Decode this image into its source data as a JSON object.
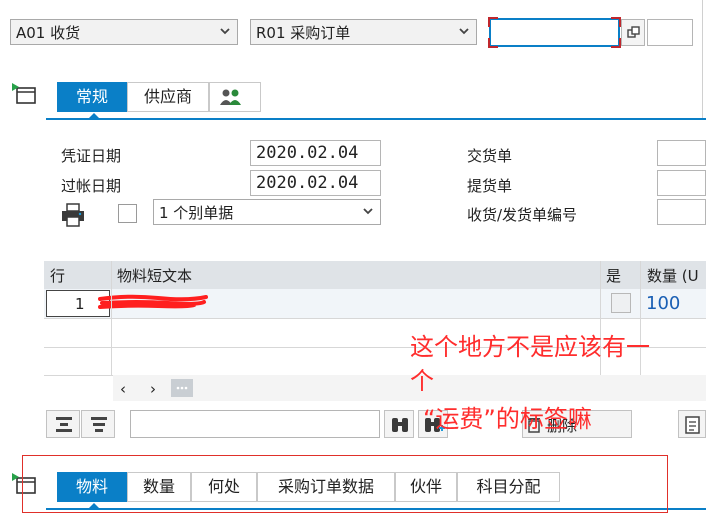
{
  "header": {
    "action": "A01 收货",
    "reference": "R01 采购订单"
  },
  "header_tabs": [
    {
      "label": "常规",
      "active": true
    },
    {
      "label": "供应商",
      "active": false
    }
  ],
  "general": {
    "doc_date_label": "凭证日期",
    "doc_date_value": "2020.02.04",
    "post_date_label": "过帐日期",
    "post_date_value": "2020.02.04",
    "slip_select": "1 个别单据",
    "delivery_note_label": "交货单",
    "bill_of_lading_label": "提货单",
    "gr_slip_label": "收货/发货单编号"
  },
  "table": {
    "headers": [
      "行",
      "物料短文本",
      "是",
      "数量 (U"
    ],
    "rows": [
      {
        "line": "1",
        "material_text": "",
        "flag": "",
        "quantity": "100"
      }
    ]
  },
  "toolbar": {
    "delete_label": "删除"
  },
  "item_tabs": [
    {
      "label": "物料",
      "active": true
    },
    {
      "label": "数量",
      "active": false
    },
    {
      "label": "何处",
      "active": false
    },
    {
      "label": "采购订单数据",
      "active": false
    },
    {
      "label": "伙伴",
      "active": false
    },
    {
      "label": "科目分配",
      "active": false
    }
  ],
  "annotation": {
    "line1": "这个地方不是应该有一",
    "line2": "个",
    "line3": "“运费”的标签嘛"
  },
  "colors": {
    "accent": "#0a7fc7",
    "annotation_red": "#ff2d2d",
    "quantity_blue": "#1a5fb4"
  }
}
